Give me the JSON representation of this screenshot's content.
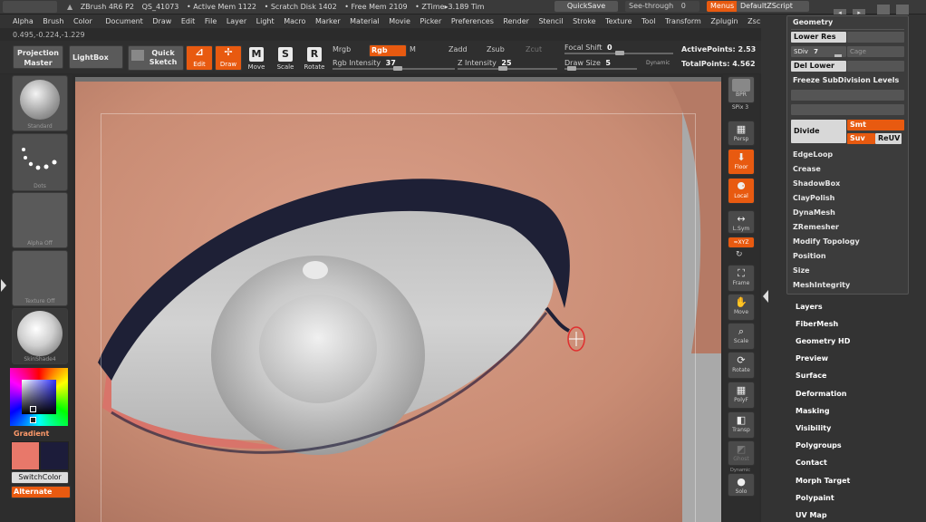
{
  "titlebar": {
    "app": "ZBrush 4R6 P2",
    "qs": "QS_41073",
    "active_mem": "• Active Mem 1122",
    "scratch": "• Scratch Disk 1402",
    "free_mem": "• Free Mem 2109",
    "ztime": "• ZTime▸3.189 Tim",
    "quicksave": "QuickSave",
    "seethrough": "See-through",
    "seethrough_val": "0",
    "menus": "Menus",
    "zscript": "DefaultZScript"
  },
  "menubar": [
    "Alpha",
    "Brush",
    "Color",
    "Document",
    "Draw",
    "Edit",
    "File",
    "Layer",
    "Light",
    "Macro",
    "Marker",
    "Material",
    "Movie",
    "Picker",
    "Preferences",
    "Render",
    "Stencil",
    "Stroke",
    "Texture",
    "Tool",
    "Transform",
    "Zplugin",
    "Zscript"
  ],
  "coords": "0.495,-0.224,-1.229",
  "shelf": {
    "projection_master": "Projection Master",
    "lightbox": "LightBox",
    "quick_sketch": "Quick Sketch",
    "edit": "Edit",
    "draw": "Draw",
    "move": "Move",
    "scale": "Scale",
    "rotate": "Rotate",
    "mrgb": "Mrgb",
    "rgb": "Rgb",
    "m": "M",
    "zadd": "Zadd",
    "zsub": "Zsub",
    "zcut": "Zcut",
    "rgb_intensity_label": "Rgb Intensity",
    "rgb_intensity": "37",
    "z_intensity_label": "Z Intensity",
    "z_intensity": "25",
    "focal_shift_label": "Focal Shift",
    "focal_shift": "0",
    "draw_size_label": "Draw Size",
    "draw_size": "5",
    "dynamic": "Dynamic",
    "active_points": "ActivePoints: 2.53",
    "total_points": "TotalPoints: 4.562"
  },
  "left": {
    "standard": "Standard",
    "dots": "Dots",
    "alpha_off": "Alpha  Off",
    "texture_off": "Texture  Off",
    "skinshade": "SkinShade4",
    "gradient": "Gradient",
    "switchcolor": "SwitchColor",
    "alternate": "Alternate",
    "main_color": "#e8786a",
    "secondary_color": "#1c1c3a"
  },
  "rightshelf": {
    "bpr": "BPR",
    "spix": "SPix",
    "spix_val": "3",
    "persp": "Persp",
    "floor": "Floor",
    "local": "Local",
    "lsym": "L.Sym",
    "xyz": "≈XYZ",
    "frame": "Frame",
    "move": "Move",
    "scale": "Scale",
    "rotate": "Rotate",
    "polyf": "PolyF",
    "transp": "Transp",
    "ghost": "Ghost",
    "dynamic": "Dynamic",
    "solo": "Solo"
  },
  "tray": {
    "title": "Geometry",
    "lower_res": "Lower Res",
    "sdiv_label": "SDiv",
    "sdiv_val": "7",
    "cage": "Cage",
    "del_lower": "Del Lower",
    "freeze": "Freeze SubDivision Levels",
    "divide": "Divide",
    "smt": "Smt",
    "suv": "Suv",
    "reuv": "ReUV",
    "items": [
      "EdgeLoop",
      "Crease",
      "ShadowBox",
      "ClayPolish",
      "DynaMesh",
      "ZRemesher",
      "Modify Topology",
      "Position",
      "Size",
      "MeshIntegrity"
    ]
  },
  "palettes": [
    "Layers",
    "FiberMesh",
    "Geometry HD",
    "Preview",
    "Surface",
    "Deformation",
    "Masking",
    "Visibility",
    "Polygroups",
    "Contact",
    "Morph Target",
    "Polypaint",
    "UV Map"
  ],
  "colors": {
    "accent": "#e85a10",
    "ui_bg": "#2b2b2b",
    "skin": "#c88d75"
  }
}
